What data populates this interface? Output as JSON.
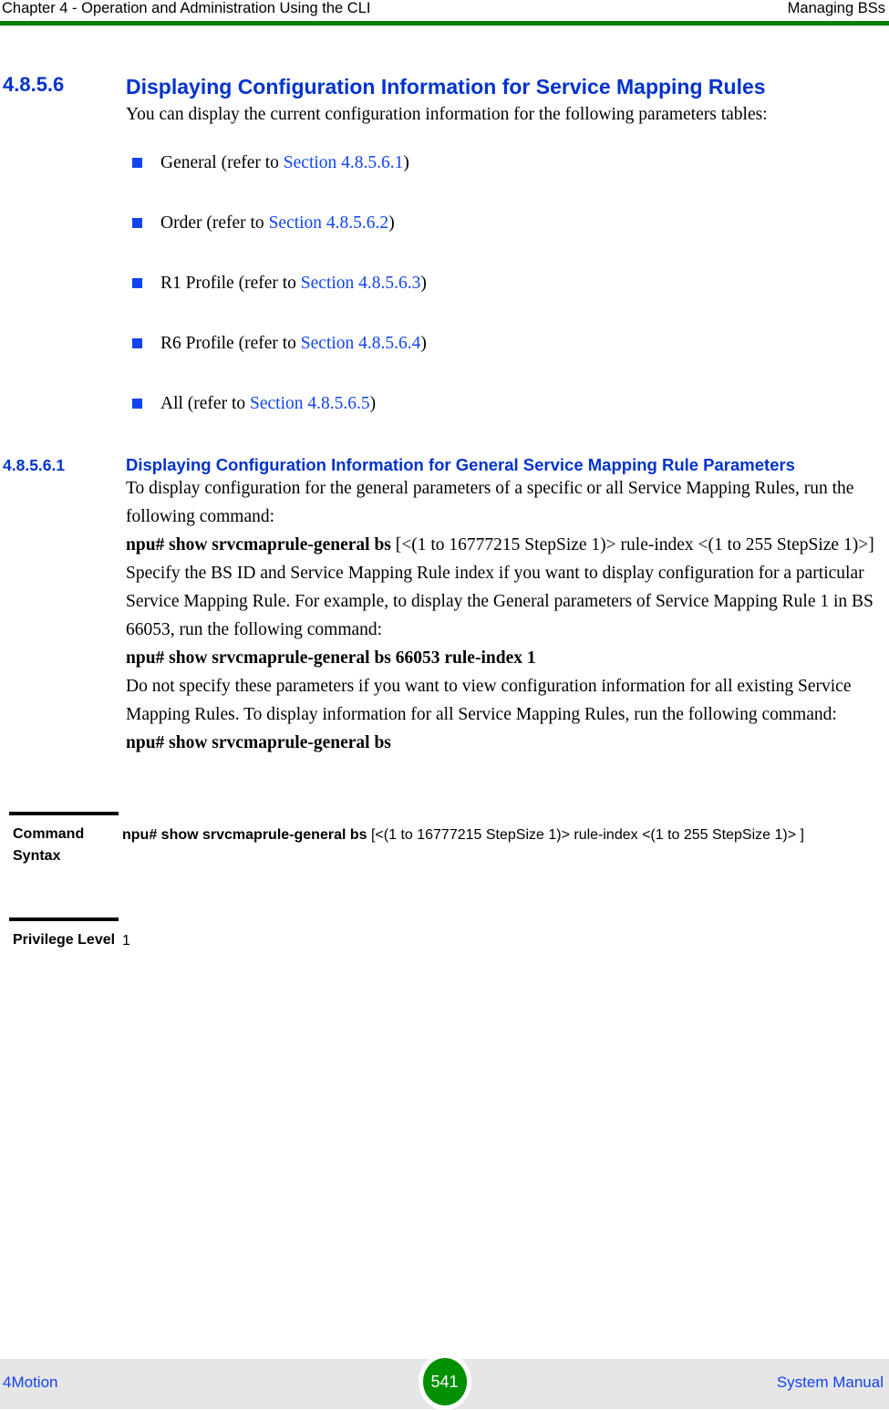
{
  "header": {
    "left": "Chapter 4 - Operation and Administration Using the CLI",
    "right": "Managing BSs",
    "rule_color": "#008000"
  },
  "section": {
    "number": "4.8.5.6",
    "title": "Displaying Configuration Information for Service Mapping Rules",
    "intro": "You can display the current configuration information for the following parameters tables:"
  },
  "bullets": [
    {
      "text": "General (refer to ",
      "link": "Section 4.8.5.6.1",
      "tail": ")"
    },
    {
      "text": "Order (refer to ",
      "link": "Section 4.8.5.6.2",
      "tail": ")"
    },
    {
      "text": "R1 Profile (refer to ",
      "link": "Section 4.8.5.6.3",
      "tail": ")"
    },
    {
      "text": "R6 Profile (refer to ",
      "link": "Section 4.8.5.6.4",
      "tail": ")"
    },
    {
      "text": "All (refer to ",
      "link": "Section 4.8.5.6.5",
      "tail": ")"
    }
  ],
  "subsection": {
    "number": "4.8.5.6.1",
    "title": "Displaying Configuration Information for General Service Mapping Rule Parameters",
    "para1": "To display configuration for the general parameters of a specific or all Service Mapping Rules, run the following command:",
    "cmd1_bold": "npu# show srvcmaprule-general bs",
    "cmd1_rest": " [<(1 to 16777215 StepSize 1)> rule-index <(1 to 255 StepSize 1)>]",
    "para2": "Specify the BS ID and Service Mapping Rule index if you want to display configuration for a particular Service Mapping Rule. For example, to display the General parameters of Service Mapping Rule 1 in BS 66053, run the following command:",
    "cmd2_bold": "npu# show srvcmaprule-general bs 66053 rule-index 1",
    "para3": "Do not specify these parameters if you want to view configuration information for all existing Service Mapping Rules. To display information for all Service Mapping Rules, run the following command:",
    "cmd3_bold": "npu# show srvcmaprule-general bs"
  },
  "param_table": {
    "rows": [
      {
        "label": "Command Syntax",
        "value_bold": "npu# show srvcmaprule-general bs",
        "value_rest": " [<(1 to 16777215 StepSize 1)> rule-index <(1 to 255 StepSize 1)> ]"
      },
      {
        "label": "Privilege Level",
        "value_bold": "",
        "value_rest": "1"
      }
    ]
  },
  "footer": {
    "left": "4Motion",
    "page": "541",
    "right": "System Manual",
    "badge_color": "#009000",
    "background": "#e6e6e6"
  },
  "colors": {
    "heading_blue": "#0033cc",
    "link_blue": "#1144ee",
    "rule_green": "#008000"
  }
}
